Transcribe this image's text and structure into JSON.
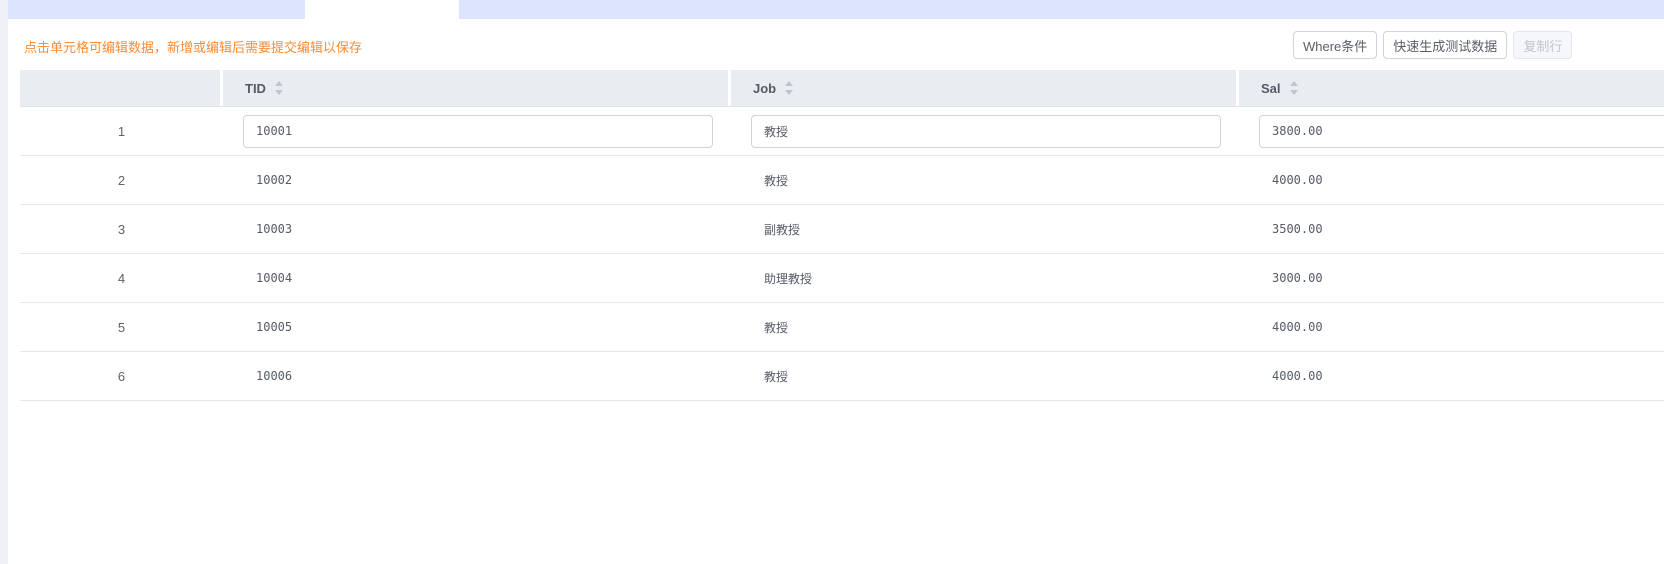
{
  "hint": "点击单元格可编辑数据，新增或编辑后需要提交编辑以保存",
  "toolbar": {
    "where": "Where条件",
    "generate": "快速生成测试数据",
    "copy": "复制行"
  },
  "columns": [
    "TID",
    "Job",
    "Sal"
  ],
  "rows": [
    {
      "idx": "1",
      "tid": "10001",
      "job": "教授",
      "sal": "3800.00"
    },
    {
      "idx": "2",
      "tid": "10002",
      "job": "教授",
      "sal": "4000.00"
    },
    {
      "idx": "3",
      "tid": "10003",
      "job": "副教授",
      "sal": "3500.00"
    },
    {
      "idx": "4",
      "tid": "10004",
      "job": "助理教授",
      "sal": "3000.00"
    },
    {
      "idx": "5",
      "tid": "10005",
      "job": "教授",
      "sal": "4000.00"
    },
    {
      "idx": "6",
      "tid": "10006",
      "job": "教授",
      "sal": "4000.00"
    }
  ]
}
